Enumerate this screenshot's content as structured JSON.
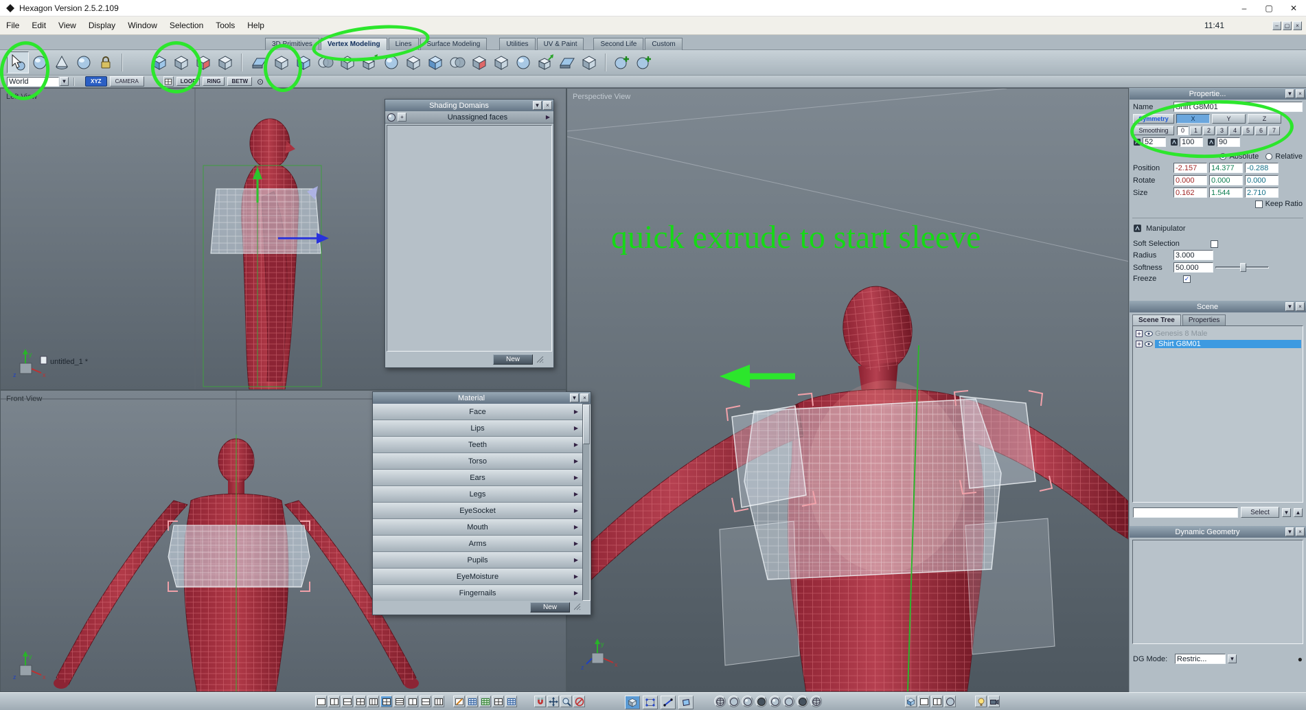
{
  "glyphs": {
    "dropdown": "▼",
    "up": "▲",
    "close": "×",
    "arrow_right": "▶",
    "plus": "+",
    "check": "✓",
    "target": "⊙",
    "dot": "●",
    "minimize": "–",
    "maximize": "▢",
    "window_close": "✕"
  },
  "window": {
    "title": "Hexagon Version 2.5.2.109",
    "time": "11:41"
  },
  "menubar": {
    "items": [
      "File",
      "Edit",
      "View",
      "Display",
      "Window",
      "Selection",
      "Tools",
      "Help"
    ]
  },
  "tabs": {
    "items": [
      "3D Primitives",
      "Vertex Modeling",
      "Lines",
      "Surface Modeling",
      "Utilities",
      "UV & Paint",
      "Second Life",
      "Custom"
    ]
  },
  "subtoolbar": {
    "world": "World",
    "xyz": "XYZ",
    "camera": "CAMERA",
    "loop": "LOOP",
    "ring": "RING",
    "betw": "BETW"
  },
  "viewports": {
    "left": {
      "label": "Left View",
      "document": "untitled_1 *"
    },
    "front": {
      "label": "Front View"
    },
    "perspective": {
      "label": "Perspective View"
    }
  },
  "annotations": {
    "note": "quick extrude to start sleeve"
  },
  "shading": {
    "title": "Shading Domains",
    "row": "Unassigned faces",
    "new_button": "New"
  },
  "material": {
    "title": "Material",
    "items": [
      "Face",
      "Lips",
      "Teeth",
      "Torso",
      "Ears",
      "Legs",
      "EyeSocket",
      "Mouth",
      "Arms",
      "Pupils",
      "EyeMoisture",
      "Fingernails"
    ],
    "new_button": "New"
  },
  "props": {
    "title": "Propertie...",
    "name_label": "Name",
    "name_value": "Shirt G8M01",
    "symmetry_label": "Symmetry",
    "axes": [
      "X",
      "Y",
      "Z"
    ],
    "smoothing_label": "Smoothing",
    "levels": [
      "0",
      "1",
      "2",
      "3",
      "4",
      "5",
      "6",
      "7"
    ],
    "ranges": [
      "52",
      "100",
      "90"
    ],
    "absolute_label": "Absolute",
    "relative_label": "Relative",
    "position_label": "Position",
    "position": [
      "-2.157",
      "14.377",
      "-0.288"
    ],
    "rotate_label": "Rotate",
    "rotate": [
      "0.000",
      "0.000",
      "0.000"
    ],
    "size_label": "Size",
    "size": [
      "0.162",
      "1.544",
      "2.710"
    ],
    "keep_ratio_label": "Keep Ratio",
    "manipulator_label": "Manipulator",
    "soft_selection_label": "Soft Selection",
    "radius_label": "Radius",
    "radius_value": "3.000",
    "softness_label": "Softness",
    "softness_value": "50.000",
    "freeze_label": "Freeze"
  },
  "scene": {
    "title": "Scene",
    "tabs": [
      "Scene Tree",
      "Properties"
    ],
    "items": [
      {
        "label": "Genesis 8 Male"
      },
      {
        "label": "Shirt G8M01"
      }
    ],
    "select_button": "Select"
  },
  "dyngeo": {
    "title": "Dynamic Geometry",
    "mode_label": "DG Mode:",
    "mode_value": "Restric..."
  },
  "colors": {
    "selection_blue": "#3d9ae1",
    "annotation_green": "#2ce62c",
    "axis_x": "#a12626",
    "axis_y": "#0c7e50",
    "axis_z": "#0f6e86",
    "figure_red": "#a02c3c"
  }
}
